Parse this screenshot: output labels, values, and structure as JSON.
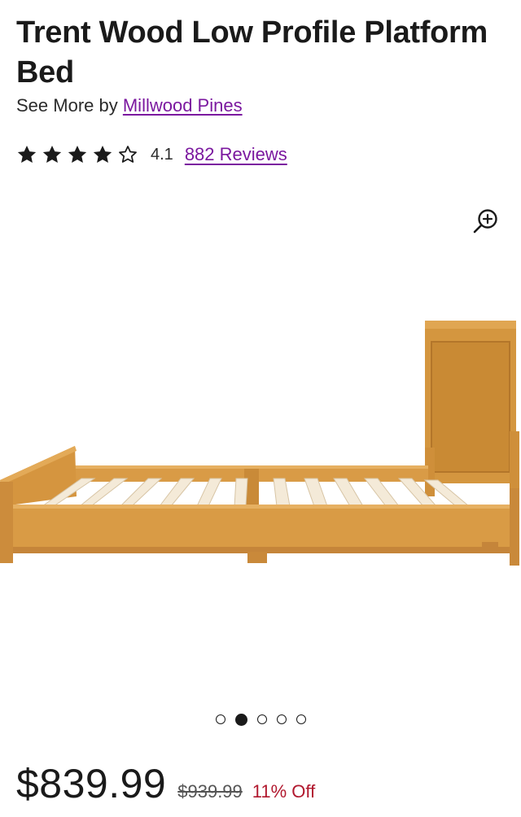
{
  "product": {
    "title": "Trent Wood Low Profile Platform Bed",
    "see_more_prefix": "See More by",
    "brand": "Millwood Pines"
  },
  "rating": {
    "value": "4.1",
    "stars_filled": 4,
    "stars_total": 5,
    "reviews_label": "882 Reviews",
    "star_color": "#1a1a1a"
  },
  "gallery": {
    "zoom_icon": "zoom-in-icon",
    "image_alt": "wooden-platform-bed",
    "dots_total": 5,
    "active_index": 1
  },
  "pricing": {
    "price": "$839.99",
    "original_price": "$939.99",
    "discount": "11% Off",
    "discount_color": "#b1182e"
  },
  "colors": {
    "link": "#7b189f",
    "wood": "#d79a46"
  }
}
